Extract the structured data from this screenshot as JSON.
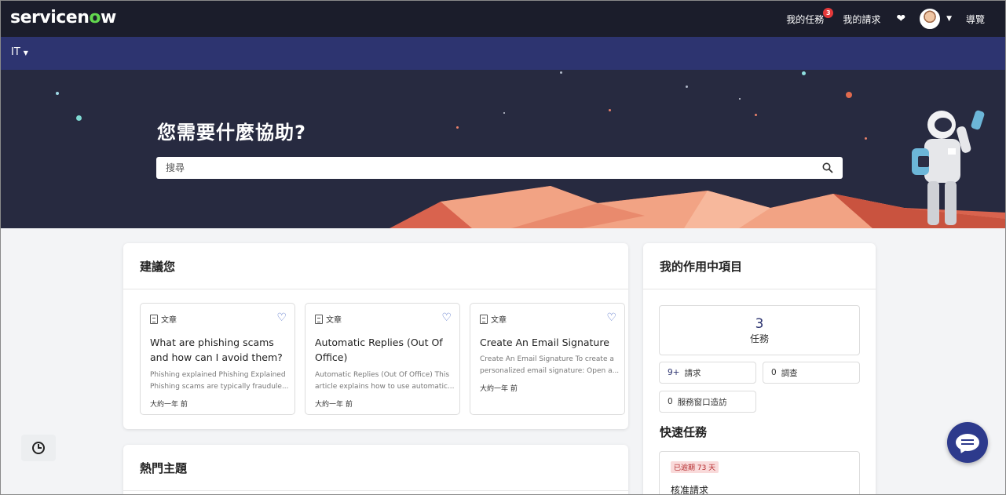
{
  "header": {
    "logo_main": "servicen",
    "logo_o": "o",
    "logo_end": "w",
    "my_tasks": "我的任務",
    "my_tasks_badge": "3",
    "my_requests": "我的請求",
    "favorites_icon": "heart-icon",
    "profile_icon": "avatar",
    "tour": "導覽"
  },
  "nav": {
    "portal": "IT"
  },
  "hero": {
    "title": "您需要什麼協助?",
    "search_placeholder": "搜尋",
    "search_icon": "search-icon"
  },
  "suggest": {
    "title": "建議您",
    "articles": [
      {
        "type": "文章",
        "title": "What are phishing scams and how can I avoid them?",
        "desc": "Phishing explained Phishing Explained Phishing scams are typically fraudule...",
        "time": "大約一年 前"
      },
      {
        "type": "文章",
        "title": "Automatic Replies (Out Of Office)",
        "desc": "Automatic Replies (Out Of Office) This article explains how to use automatic...",
        "time": "大約一年 前"
      },
      {
        "type": "文章",
        "title": "Create An Email Signature",
        "desc": "Create An Email Signature To create a personalized email signature: Open a...",
        "time": "大約一年 前"
      }
    ]
  },
  "active": {
    "title": "我的作用中項目",
    "tasks_count": "3",
    "tasks_label": "任務",
    "requests_count": "9+",
    "requests_label": "請求",
    "surveys_count": "0",
    "surveys_label": "調查",
    "walkup_count": "0",
    "walkup_label": "服務窗口造訪",
    "quick_title": "快速任務",
    "overdue": "已逾期 73 天",
    "quick_item": "核准請求"
  },
  "popular": {
    "title": "熱門主題"
  },
  "colors": {
    "topbar": "#1b1d2b",
    "navbar": "#2d3470",
    "hero": "#272a40",
    "accent": "#4a68c5",
    "logo_green": "#62d84e",
    "chat": "#2d3a8c"
  }
}
